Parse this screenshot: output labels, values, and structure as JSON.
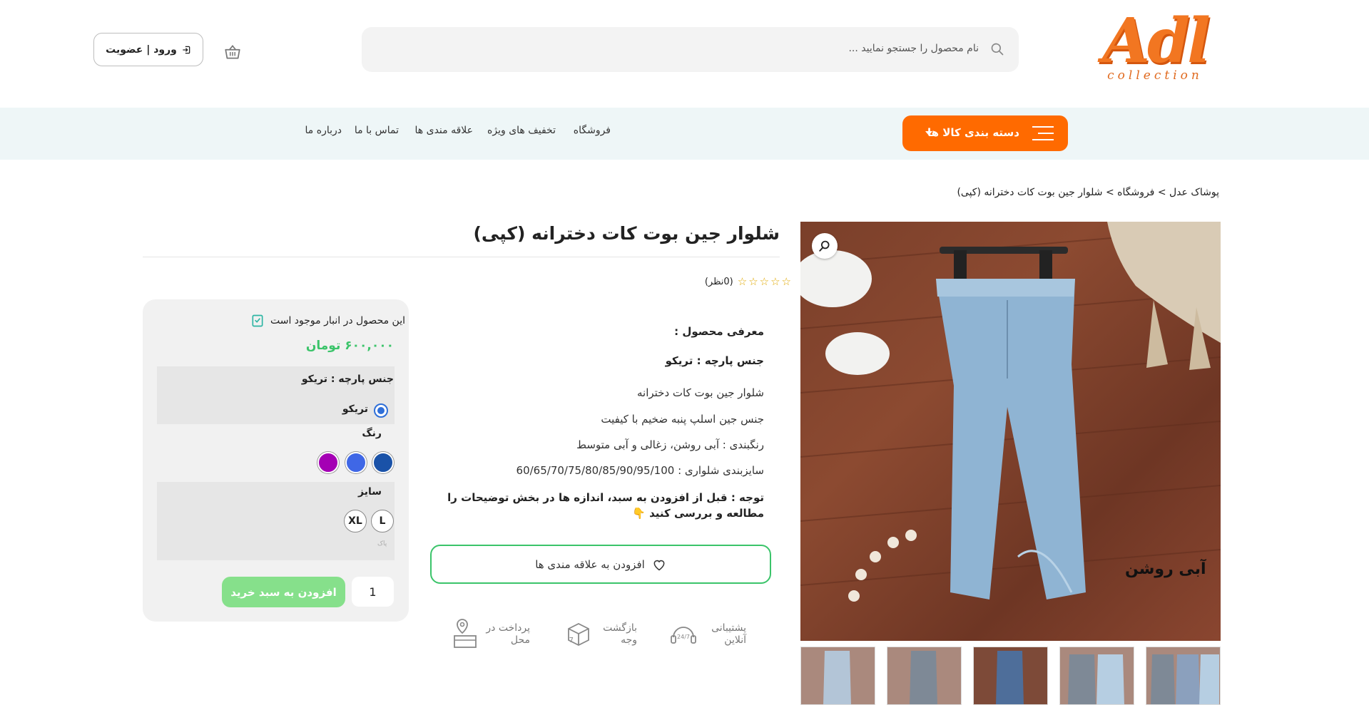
{
  "header": {
    "logo_text": "Adl",
    "logo_subtext": "collection",
    "search_placeholder": "نام محصول را جستجو نمایید ...",
    "login_label": "ورود | عضویت"
  },
  "nav": {
    "category_button": "دسته بندی کالا ها",
    "links": [
      "فروشگاه",
      "تخفیف های ویژه",
      "علاقه مندی ها",
      "تماس با ما",
      "درباره ما"
    ]
  },
  "breadcrumb": "پوشاک عدل > فروشگاه > شلوار جین بوت کات دخترانه (کپی)",
  "product": {
    "title": "شلوار جین بوت کات دخترانه (کپی)",
    "reviews": "(0نظر)",
    "stars": "☆☆☆☆☆",
    "intro_heading": "معرفی محصول :",
    "fabric_heading": "جنس پارچه : تریکو",
    "lines": [
      "شلوار جین بوت کات دخترانه",
      "جنس جین اسلپ پنبه ضخیم با کیفیت",
      "رنگبندی : آبی روشن، زغالی و آبی متوسط",
      "سایزبندی شلواری : 60/65/70/75/80/85/90/95/100"
    ],
    "note": "توجه : قبل از افزودن به سبد، اندازه ها در بخش توضیحات را مطالعه و بررسی کنید 👇",
    "wishlist_label": "افزودن به علاقه مندی ها",
    "image_caption": "آبی روشن"
  },
  "features": [
    {
      "icon": "support-24-7-icon",
      "label": "پشتیبانی آنلاین"
    },
    {
      "icon": "money-back-7-days-icon",
      "label": "بازگشت وجه"
    },
    {
      "icon": "pay-on-delivery-icon",
      "label": "پرداخت در محل"
    }
  ],
  "purchase": {
    "stock_text": "این محصول در انبار موجود است",
    "price": "۶۰۰,۰۰۰ تومان",
    "fabric_label": "جنس پارچه : تریکو",
    "fabric_option": "تریکو",
    "color_label": "رنگ",
    "colors": [
      "#1a52a8",
      "#3f67e6",
      "#a400b4"
    ],
    "size_label": "سایز",
    "sizes": [
      "L",
      "XL"
    ],
    "clear_label": "پاک",
    "quantity": "1",
    "add_to_cart": "افزودن به سبد خرید"
  },
  "colors": {
    "accent": "#ff6a00",
    "success": "#3bc46a",
    "nav_bg": "#eef6f7"
  }
}
